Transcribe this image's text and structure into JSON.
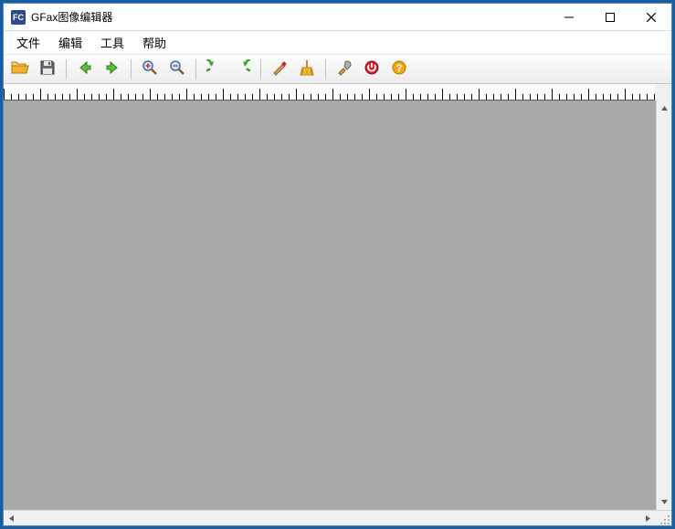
{
  "app": {
    "icon_text": "FC",
    "title": "GFax图像编辑器"
  },
  "menus": {
    "file": "文件",
    "edit": "编辑",
    "tools": "工具",
    "help": "帮助"
  },
  "toolbar": {
    "open": "open",
    "save": "save",
    "back": "back",
    "forward": "forward",
    "zoom_in": "zoom-in",
    "zoom_out": "zoom-out",
    "undo": "undo",
    "redo": "redo",
    "brush": "brush",
    "clean": "clean",
    "settings": "settings",
    "power": "power",
    "help": "help"
  },
  "colors": {
    "canvas_bg": "#a9a9a9",
    "window_border": "#4a8bc2",
    "desktop_bg": "#1b5d9a"
  }
}
